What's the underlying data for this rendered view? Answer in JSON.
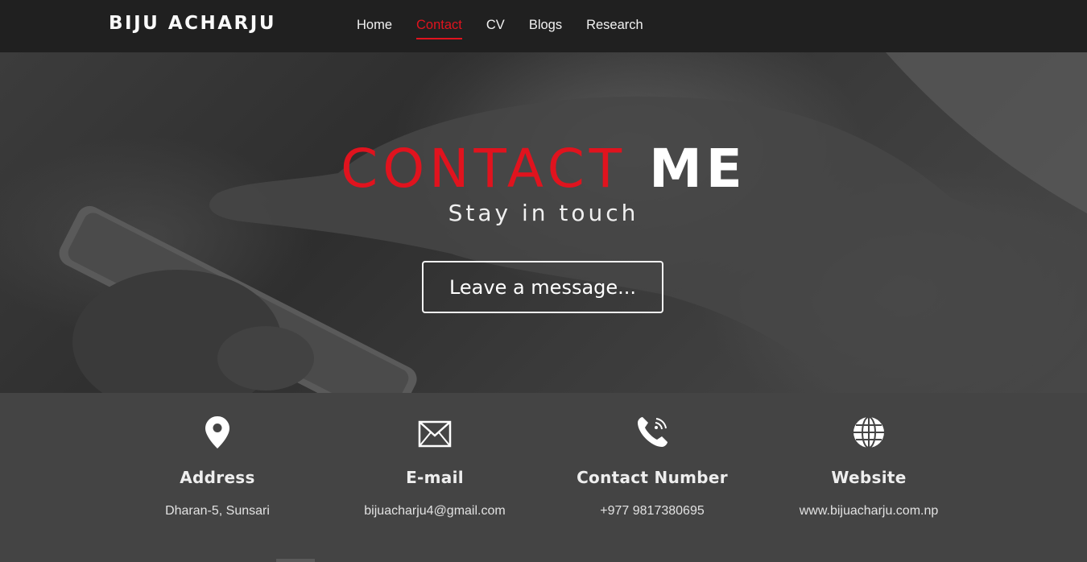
{
  "navbar": {
    "brand": "BIJU ACHARJU",
    "links": [
      {
        "label": "Home",
        "active": false
      },
      {
        "label": "Contact",
        "active": true
      },
      {
        "label": "CV",
        "active": false
      },
      {
        "label": "Blogs",
        "active": false
      },
      {
        "label": "Research",
        "active": false
      }
    ]
  },
  "hero": {
    "title_red": "CONTACT",
    "title_white": "ME",
    "subtitle": "Stay in touch",
    "button_label": "Leave a message..."
  },
  "contact_info": [
    {
      "icon": "location-pin-icon",
      "label": "Address",
      "value": "Dharan-5, Sunsari"
    },
    {
      "icon": "envelope-icon",
      "label": "E-mail",
      "value": "bijuacharju4@gmail.com"
    },
    {
      "icon": "phone-icon",
      "label": "Contact Number",
      "value": "+977 9817380695"
    },
    {
      "icon": "globe-icon",
      "label": "Website",
      "value": "www.bijuacharju.com.np"
    }
  ],
  "colors": {
    "accent": "#e0131e",
    "navbar_bg": "#202020",
    "info_bg": "#444444"
  }
}
